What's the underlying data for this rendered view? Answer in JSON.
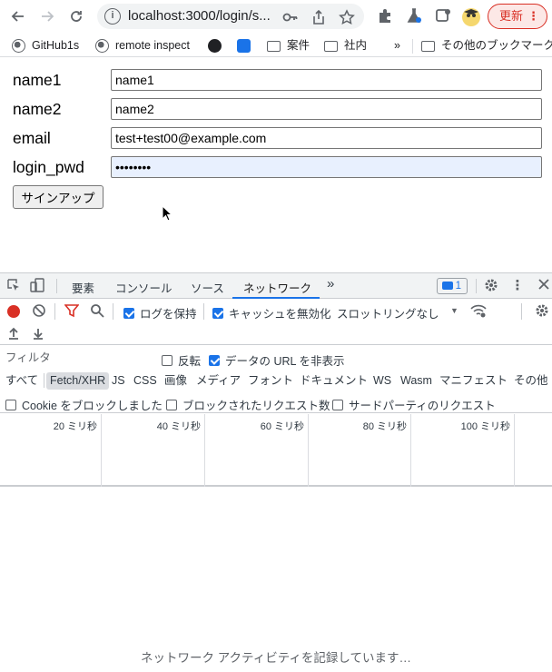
{
  "browser": {
    "url": "localhost:3000/login/s...",
    "update_label": "更新",
    "update_menu": "⋮"
  },
  "bookmarks": {
    "items": [
      {
        "label": "GitHub1s"
      },
      {
        "label": "remote inspect"
      },
      {
        "label": ""
      },
      {
        "label": ""
      },
      {
        "label": "案件"
      },
      {
        "label": "社内"
      }
    ],
    "overflow": "»",
    "other": "その他のブックマーク"
  },
  "form": {
    "name1_label": "name1",
    "name1_value": "name1",
    "name2_label": "name2",
    "name2_value": "name2",
    "email_label": "email",
    "email_value": "test+test00@example.com",
    "pwd_label": "login_pwd",
    "pwd_value": "••••••••",
    "signup_label": "サインアップ"
  },
  "devtools": {
    "tabs": [
      "要素",
      "コンソール",
      "ソース",
      "ネットワーク"
    ],
    "more": "»",
    "message_count": "1",
    "preserve_log": "ログを保持",
    "disable_cache": "キャッシュを無効化",
    "throttling": "スロットリングなし",
    "filter_placeholder": "フィルタ",
    "invert": "反転",
    "hide_data_urls": "データの URL を非表示",
    "types": [
      "すべて",
      "Fetch/XHR",
      "JS",
      "CSS",
      "画像",
      "メディア",
      "フォント",
      "ドキュメント",
      "WS",
      "Wasm",
      "マニフェスト",
      "その他"
    ],
    "active_type": "Fetch/XHR",
    "blocked_cookies": "Cookie をブロックしました",
    "blocked_requests": "ブロックされたリクエスト数",
    "third_party": "サードパーティのリクエスト",
    "timeline_ticks": [
      "20 ミリ秒",
      "40 ミリ秒",
      "60 ミリ秒",
      "80 ミリ秒",
      "100 ミリ秒"
    ],
    "recording_text": "ネットワーク アクティビティを記録しています…",
    "preserve_log_checked": true,
    "disable_cache_checked": true,
    "invert_checked": false,
    "hide_data_urls_checked": true,
    "blocked_cookies_checked": false,
    "blocked_requests_checked": false,
    "third_party_checked": false
  },
  "colors": {
    "accent": "#1a73e8",
    "record": "#d93025",
    "filter_icon": "#d93025"
  }
}
